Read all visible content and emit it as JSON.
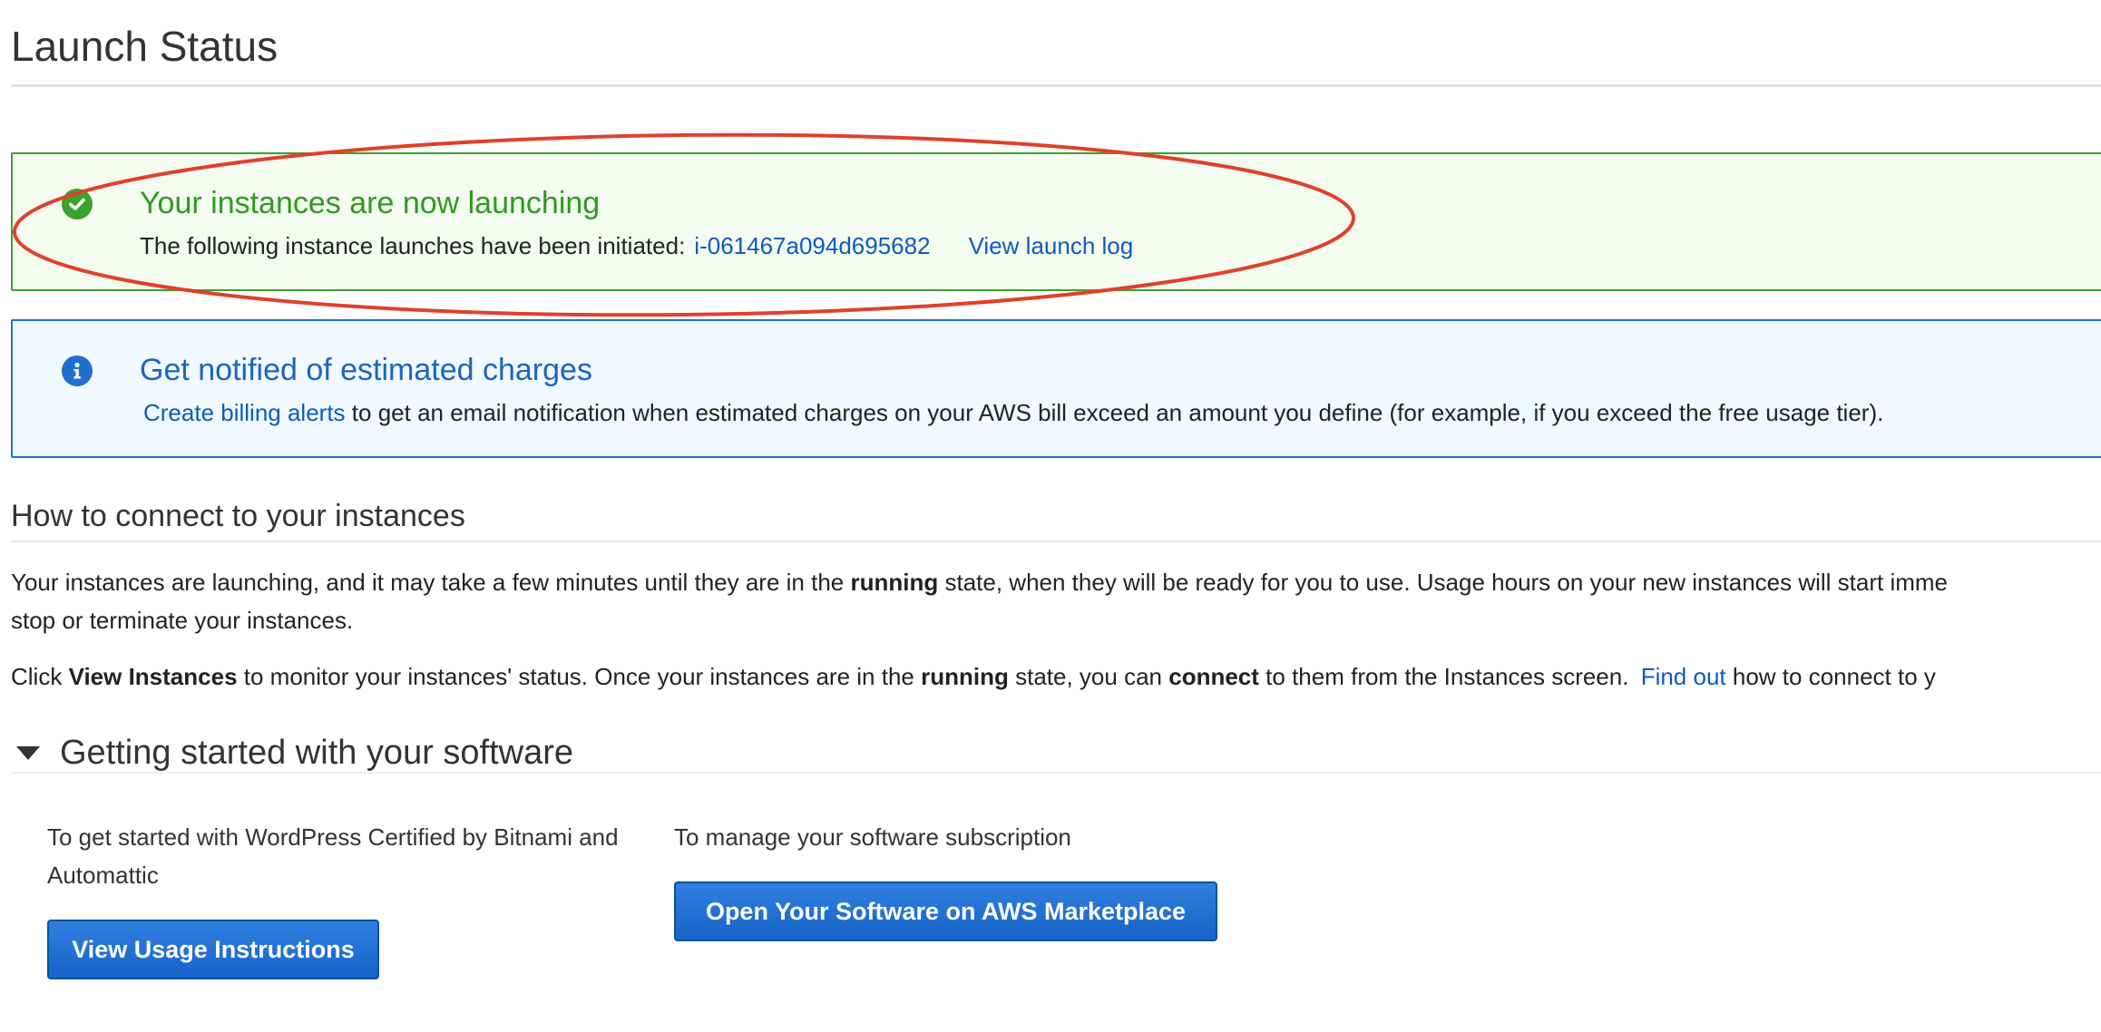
{
  "page": {
    "title": "Launch Status"
  },
  "success_alert": {
    "heading": "Your instances are now launching",
    "body_text": "The following instance launches have been initiated:",
    "instance_id": "i-061467a094d695682",
    "view_log_link": "View launch log",
    "icon": "check-circle-icon",
    "color": "#3ba22b"
  },
  "info_alert": {
    "heading": "Get notified of estimated charges",
    "link": "Create billing alerts",
    "body_text": "to get an email notification when estimated charges on your AWS bill exceed an amount you define (for example, if you exceed the free usage tier).",
    "icon": "info-circle-icon",
    "color": "#1f6fcf"
  },
  "connect": {
    "title": "How to connect to your instances",
    "para1": {
      "t1": "Your instances are launching, and it may take a few minutes until they are in the",
      "b1": "running",
      "t2": "state, when they will be ready for you to use. Usage hours on your new instances will start imme",
      "line2": "stop or terminate your instances."
    },
    "para2": {
      "t1": "Click",
      "b1": "View Instances",
      "t2": "to monitor your instances' status. Once your instances are in the",
      "b2": "running",
      "t3": "state, you can",
      "b3": "connect",
      "t4": "to them from the Instances screen.",
      "link": "Find out",
      "t5": "how to connect to y"
    }
  },
  "getting_started": {
    "title": "Getting started with your software",
    "left_text": "To get started with WordPress Certified by Bitnami and Automattic",
    "left_button": "View Usage Instructions",
    "right_text": "To manage your software subscription",
    "right_button": "Open Your Software on AWS Marketplace"
  },
  "annotation": {
    "color": "#e0402a"
  }
}
